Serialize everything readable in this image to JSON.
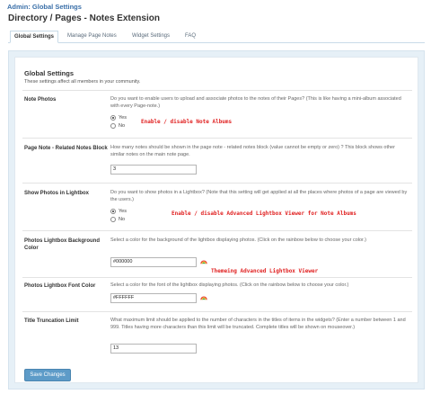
{
  "header": {
    "admin_crumb": "Admin: Global Settings",
    "page_title": "Directory / Pages - Notes Extension"
  },
  "tabs": [
    {
      "label": "Global Settings",
      "active": true
    },
    {
      "label": "Manage Page Notes",
      "active": false
    },
    {
      "label": "Widget Settings",
      "active": false
    },
    {
      "label": "FAQ",
      "active": false
    }
  ],
  "section": {
    "title": "Global Settings",
    "desc": "These settings affect all members in your community."
  },
  "rows": {
    "note_photos": {
      "label": "Note Photos",
      "desc": "Do you want to enable users to upload and associate photos to the notes of their Pages? (This is like having a mini-album associated with every Page-note.)",
      "yes": "Yes",
      "no": "No",
      "selected": "Yes"
    },
    "related": {
      "label": "Page Note - Related Notes Block",
      "desc": "How many notes should be shown in the page note - related notes block (value cannot be empty or zero) ? This block shows other similar notes on the main note page.",
      "value": "3"
    },
    "lightbox": {
      "label": "Show Photos in Lightbox",
      "desc": "Do you want to show photos in a Lightbox? (Note that this setting will get applied at all the places where photos of a page are viewed by the users.)",
      "yes": "Yes",
      "no": "No",
      "selected": "Yes"
    },
    "bg_color": {
      "label": "Photos Lightbox Background Color",
      "desc": "Select a color for the background of the lightbox displaying photos. (Click on the rainbow below to choose your color.)",
      "value": "#000000"
    },
    "font_color": {
      "label": "Photos Lightbox Font Color",
      "desc": "Select a color for the font of the lightbox displaying photos. (Click on the rainbow below to choose your color.)",
      "value": "#FFFFFF"
    },
    "truncation": {
      "label": "Title Truncation Limit",
      "desc": "What maximum limit should be applied to the number of characters in the titles of items in the widgets? (Enter a number between 1 and 999. Titles having more characters than this limit will be truncated. Complete titles will be shown on mouseover.)",
      "value": "13"
    }
  },
  "annotations": {
    "note_albums": "Enable / disable Note Albums",
    "lightbox_viewer": "Enable / disable Advanced Lightbox Viewer for Note Albums",
    "theming": "Themeing Advanced Lightbox Viewer"
  },
  "save_label": "Save Changes",
  "colors": {
    "accent": "#3a6fa8",
    "button": "#5d9bc8",
    "annotation": "#e02020",
    "panel_bg": "#e6f0f7"
  },
  "icons": {
    "rainbow": "rainbow-color-picker-icon",
    "radio": "radio-button-icon"
  }
}
